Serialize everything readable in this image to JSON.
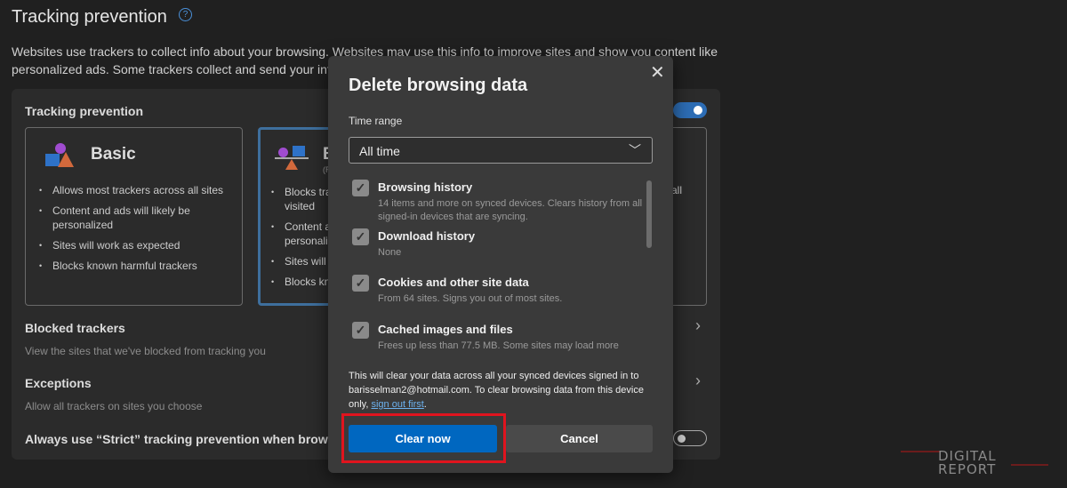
{
  "page": {
    "title": "Tracking prevention",
    "description": "Websites use trackers to collect info about your browsing. Websites may use this info to improve sites and show you content like personalized ads. Some trackers collect and send your info t"
  },
  "panel": {
    "label": "Tracking prevention",
    "toggle_on": true,
    "cards": [
      {
        "title": "Basic",
        "bullets": [
          "Allows most trackers across all sites",
          "Content and ads will likely be personalized",
          "Sites will work as expected",
          "Blocks known harmful trackers"
        ]
      },
      {
        "title": "B",
        "subtitle": "(R",
        "bullets": [
          "Blocks tra visited",
          "Content a personaliz",
          "Sites will",
          "Blocks kn"
        ],
        "selected": true
      },
      {
        "bullet_fragment": "all"
      }
    ],
    "blocked": {
      "label": "Blocked trackers",
      "sub": "View the sites that we've blocked from tracking you"
    },
    "exceptions": {
      "label": "Exceptions",
      "sub": "Allow all trackers on sites you choose"
    },
    "strict": {
      "label": "Always use “Strict” tracking prevention when browsing",
      "toggle_on": false
    }
  },
  "dialog": {
    "title": "Delete browsing data",
    "close": "✕",
    "time_range_label": "Time range",
    "time_range_value": "All time",
    "items": [
      {
        "label": "Browsing history",
        "desc": "14 items and more on synced devices. Clears history from all signed-in devices that are syncing.",
        "checked": true
      },
      {
        "label": "Download history",
        "desc": "None",
        "checked": true
      },
      {
        "label": "Cookies and other site data",
        "desc": "From 64 sites. Signs you out of most sites.",
        "checked": true
      },
      {
        "label": "Cached images and files",
        "desc": "Frees up less than 77.5 MB. Some sites may load more",
        "checked": true
      }
    ],
    "note": "This will clear your data across all your synced devices signed in to barisselman2@hotmail.com. To clear browsing data from this device only, ",
    "note_link": "sign out first",
    "note_end": ".",
    "clear": "Clear now",
    "cancel": "Cancel"
  },
  "watermark": "DIGITAL REPORT",
  "colors": {
    "accent": "#0067c0",
    "highlight": "#e0141e"
  }
}
